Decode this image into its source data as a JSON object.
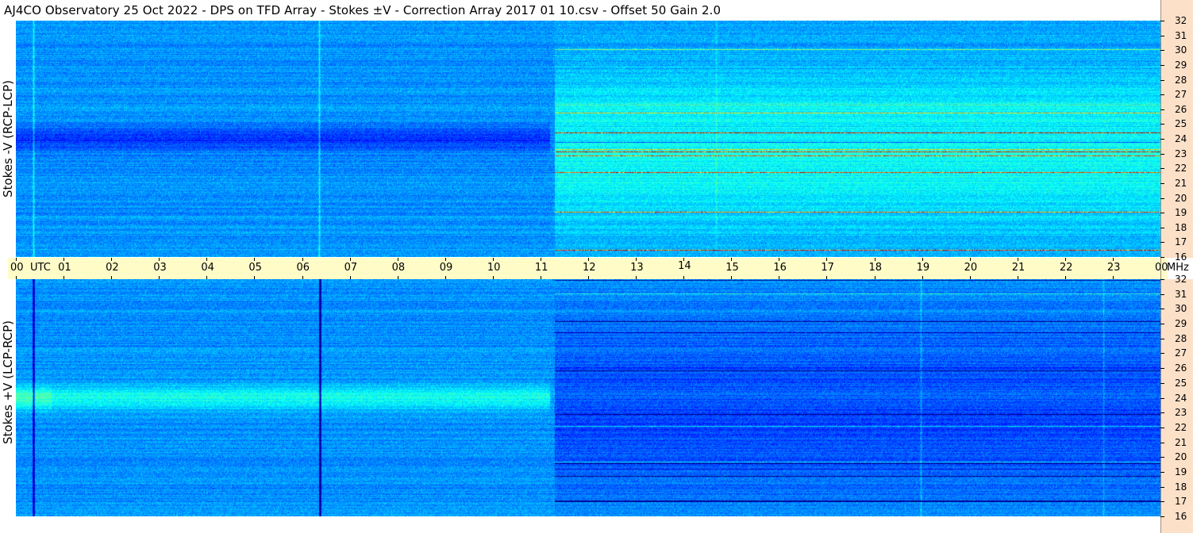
{
  "title": "AJ4CO Observatory  25 Oct 2022  -  DPS on TFD Array  -  Stokes ±V  -  Correction Array 2017 01 10.csv  -  Offset 50  Gain 2.0",
  "colors": {
    "time_bar": "#fffcc8",
    "freq_strip": "#fce0c8"
  },
  "chart_data": [
    {
      "type": "heatmap",
      "panel": "top",
      "ylabel": "Stokes -V (RCP-LCP)",
      "x_ticks": [
        "00",
        "UTC",
        "01",
        "02",
        "03",
        "04",
        "05",
        "06",
        "07",
        "08",
        "09",
        "10",
        "11",
        "12",
        "13",
        "14",
        "15",
        "16",
        "17",
        "18",
        "19",
        "20",
        "21",
        "22",
        "23",
        "00",
        "MHz"
      ],
      "x_range_hours": [
        0,
        24
      ],
      "y_ticks": [
        "16",
        "17",
        "18",
        "19",
        "20",
        "21",
        "22",
        "23",
        "24",
        "25",
        "26",
        "27",
        "28",
        "29",
        "30",
        "31",
        "32"
      ],
      "y_range_mhz": [
        16,
        32
      ],
      "colormap": "jet"
    },
    {
      "type": "heatmap",
      "panel": "bottom",
      "ylabel": "Stokes +V (LCP-RCP)",
      "x_ticks": [
        "00",
        "UTC",
        "01",
        "02",
        "03",
        "04",
        "05",
        "06",
        "07",
        "08",
        "09",
        "10",
        "11",
        "12",
        "13",
        "14",
        "15",
        "16",
        "17",
        "18",
        "19",
        "20",
        "21",
        "22",
        "23",
        "00",
        "MHz"
      ],
      "x_range_hours": [
        0,
        24
      ],
      "y_ticks": [
        "16",
        "17",
        "18",
        "19",
        "20",
        "21",
        "22",
        "23",
        "24",
        "25",
        "26",
        "27",
        "28",
        "29",
        "30",
        "31",
        "32"
      ],
      "y_range_mhz": [
        16,
        32
      ],
      "colormap": "jet"
    }
  ]
}
